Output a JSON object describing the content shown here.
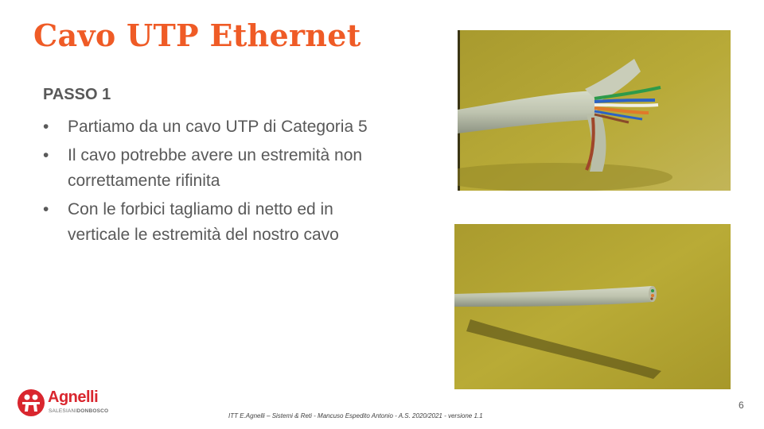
{
  "slide": {
    "title": "Cavo UTP Ethernet",
    "subtitle": "PASSO 1",
    "bullet_glyph": "•",
    "bullets": [
      "Partiamo da un cavo UTP di Categoria 5",
      "Il cavo potrebbe avere un estremità non correttamente rifinita",
      "Con le forbici tagliamo di netto ed in verticale le estremità del nostro cavo"
    ]
  },
  "images": {
    "photo_background": "#b5a632",
    "cable_color": "#c4c9b6",
    "wire_colors": [
      "#2e9a4a",
      "#2c62c4",
      "#f2f2f2",
      "#e07a2a",
      "#8a4a2a"
    ]
  },
  "logo": {
    "name": "Agnelli",
    "sub_a": "SALESIANI",
    "sub_b": "DONBOSCO",
    "brand_color": "#d9262e",
    "icon": "people-icon"
  },
  "footer": {
    "text": "ITT E.Agnelli – Sistemi & Reti - Mancuso Espedito Antonio - A.S. 2020/2021 - versione 1.1"
  },
  "page_number": "6",
  "colors": {
    "title": "#ef5b26",
    "body_text": "#595959"
  }
}
